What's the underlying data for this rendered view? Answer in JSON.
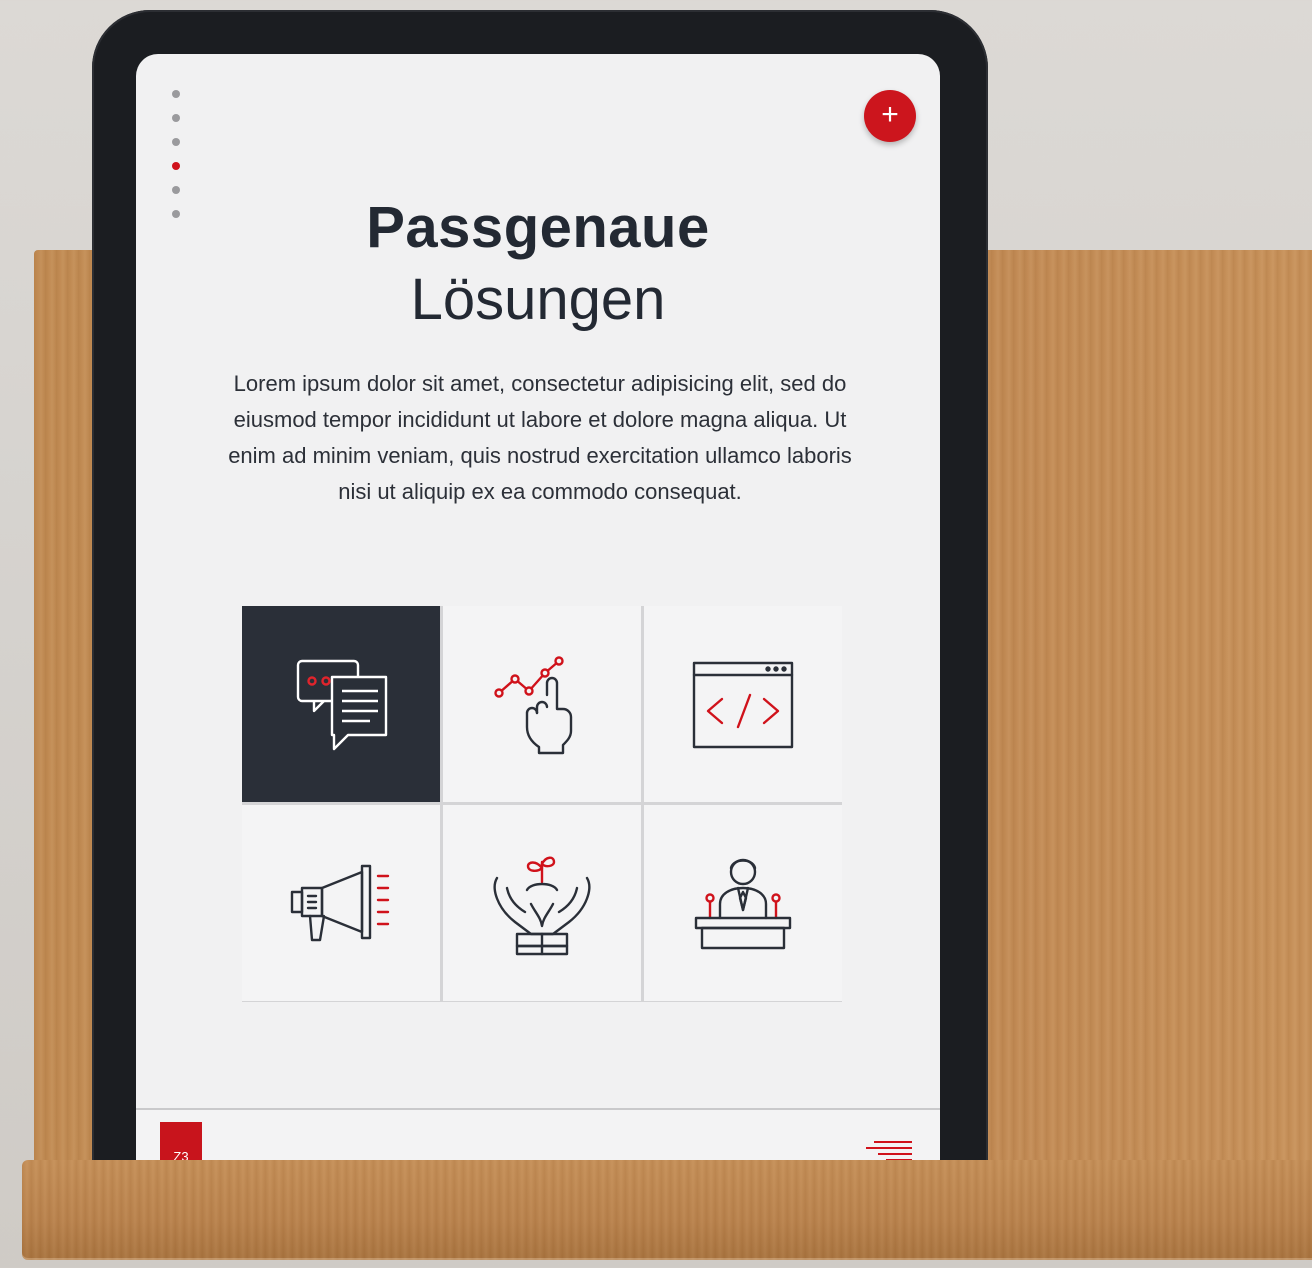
{
  "colors": {
    "accent": "#cc151d",
    "dark": "#2a2f38"
  },
  "nav": {
    "dots": [
      "section-1",
      "section-2",
      "section-3",
      "section-4",
      "section-5",
      "section-6"
    ],
    "active_index": 3
  },
  "header": {
    "plus_label": "+"
  },
  "hero": {
    "title_bold": "Passgenaue",
    "title_light": "Lösungen",
    "paragraph": "Lorem ipsum dolor sit amet, consectetur adipisicing elit, sed do eiusmod tempor incididunt ut labore et dolore magna aliqua. Ut enim ad minim veniam, quis nostrud exercitation ullamco laboris nisi ut aliquip ex ea commodo consequat."
  },
  "tiles": [
    {
      "icon": "chat-bubbles-icon",
      "selected": true
    },
    {
      "icon": "touch-growth-chart-icon",
      "selected": false
    },
    {
      "icon": "code-window-icon",
      "selected": false
    },
    {
      "icon": "megaphone-icon",
      "selected": false
    },
    {
      "icon": "hands-plant-icon",
      "selected": false
    },
    {
      "icon": "speaker-podium-icon",
      "selected": false
    }
  ],
  "footer": {
    "logo_text": "Z3",
    "menu_icon": "menu-lines-icon"
  }
}
